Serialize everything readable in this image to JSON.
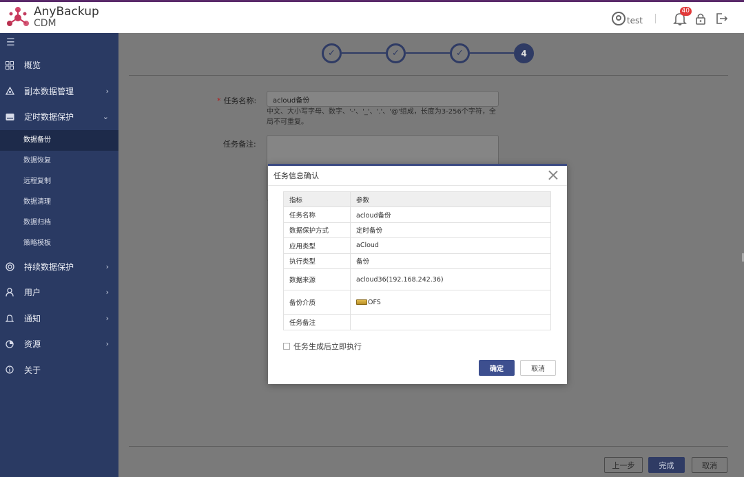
{
  "app": {
    "brand_line1": "AnyBackup",
    "brand_line2": "CDM"
  },
  "header": {
    "username": "test",
    "notification_count": "40"
  },
  "sidebar": {
    "items": [
      {
        "label": "概览",
        "icon": "grid-icon"
      },
      {
        "label": "副本数据管理",
        "icon": "copy-data-icon"
      },
      {
        "label": "定时数据保护",
        "icon": "drive-icon"
      },
      {
        "label": "持续数据保护",
        "icon": "continuous-icon"
      },
      {
        "label": "用户",
        "icon": "user-icon"
      },
      {
        "label": "通知",
        "icon": "bell-icon"
      },
      {
        "label": "资源",
        "icon": "pie-icon"
      },
      {
        "label": "关于",
        "icon": "info-icon"
      }
    ],
    "sub_items": [
      "数据备份",
      "数据恢复",
      "远程复制",
      "数据清理",
      "数据归档",
      "策略模板"
    ]
  },
  "wizard": {
    "steps": [
      "4"
    ],
    "task_name_label": "任务名称:",
    "task_name_value": "acloud备份",
    "task_name_help": "中文、大小写字母、数字、'-'、'_'、'.'、'@'组成，长度为3-256个字符，全局不可重复。",
    "task_note_label": "任务备注:",
    "prev_label": "上一步",
    "finish_label": "完成",
    "cancel_label": "取消"
  },
  "modal": {
    "title": "任务信息确认",
    "col_key": "指标",
    "col_value": "参数",
    "rows": [
      {
        "key": "任务名称",
        "value": "acloud备份"
      },
      {
        "key": "数据保护方式",
        "value": "定时备份"
      },
      {
        "key": "应用类型",
        "value": "aCloud"
      },
      {
        "key": "执行类型",
        "value": "备份"
      },
      {
        "key": "数据来源",
        "value": "acloud36(192.168.242.36)"
      },
      {
        "key": "备份介质",
        "value": "OFS"
      },
      {
        "key": "任务备注",
        "value": ""
      }
    ],
    "run_now_label": "任务生成后立即执行",
    "confirm_label": "确定",
    "cancel_label": "取消"
  }
}
